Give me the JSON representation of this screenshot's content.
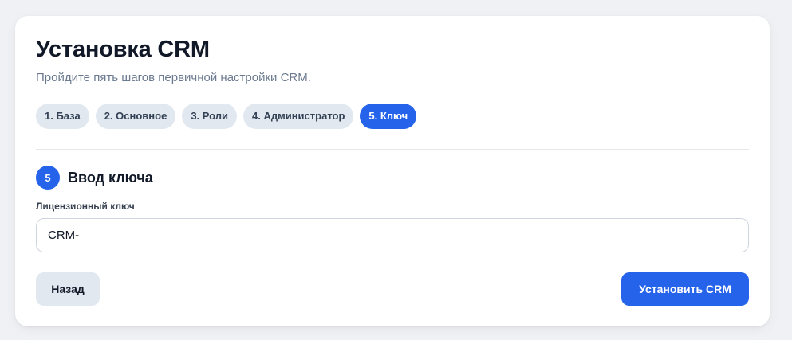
{
  "header": {
    "title": "Установка CRM",
    "subtitle": "Пройдите пять шагов первичной настройки CRM."
  },
  "steps": [
    {
      "label": "1. База",
      "active": false
    },
    {
      "label": "2. Основное",
      "active": false
    },
    {
      "label": "3. Роли",
      "active": false
    },
    {
      "label": "4. Администратор",
      "active": false
    },
    {
      "label": "5. Ключ",
      "active": true
    }
  ],
  "section": {
    "number": "5",
    "title": "Ввод ключа"
  },
  "license_field": {
    "label": "Лицензионный ключ",
    "value": "CRM-"
  },
  "actions": {
    "back_label": "Назад",
    "install_label": "Установить CRM"
  },
  "colors": {
    "accent": "#2563eb",
    "chip_bg": "#e2e8f0",
    "page_bg": "#f0f1f4"
  }
}
